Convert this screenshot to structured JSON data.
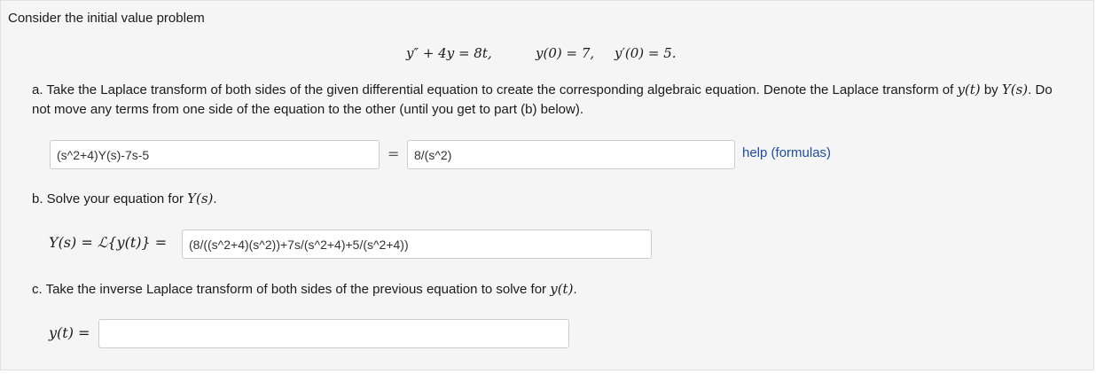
{
  "problem": {
    "intro": "Consider the initial value problem",
    "equation": "y″ + 4y = 8t,",
    "initial_condition_1": "y(0) = 7,",
    "initial_condition_2": "y′(0) = 5."
  },
  "part_a": {
    "text_1": "a. Take the Laplace transform of both sides of the given differential equation to create the corresponding algebraic equation. Denote the Laplace transform of ",
    "math_1": "y(t)",
    "text_2": " by ",
    "math_2": "Y(s)",
    "text_3": ". Do not move any terms from one side of the equation to the other (until you get to part (b) below).",
    "lhs_value": "(s^2+4)Y(s)-7s-5",
    "equals": "=",
    "rhs_value": "8/(s^2)",
    "help_link": "help (formulas)"
  },
  "part_b": {
    "text_1": "b. Solve your equation for ",
    "math_1": "Y(s)",
    "text_2": ".",
    "label": "Y(s) = ℒ{y(t)} =",
    "value": "(8/((s^2+4)(s^2))+7s/(s^2+4)+5/(s^2+4))"
  },
  "part_c": {
    "text_1": "c. Take the inverse Laplace transform of both sides of the previous equation to solve for ",
    "math_1": "y(t)",
    "text_2": ".",
    "label": "y(t) =",
    "value": ""
  }
}
